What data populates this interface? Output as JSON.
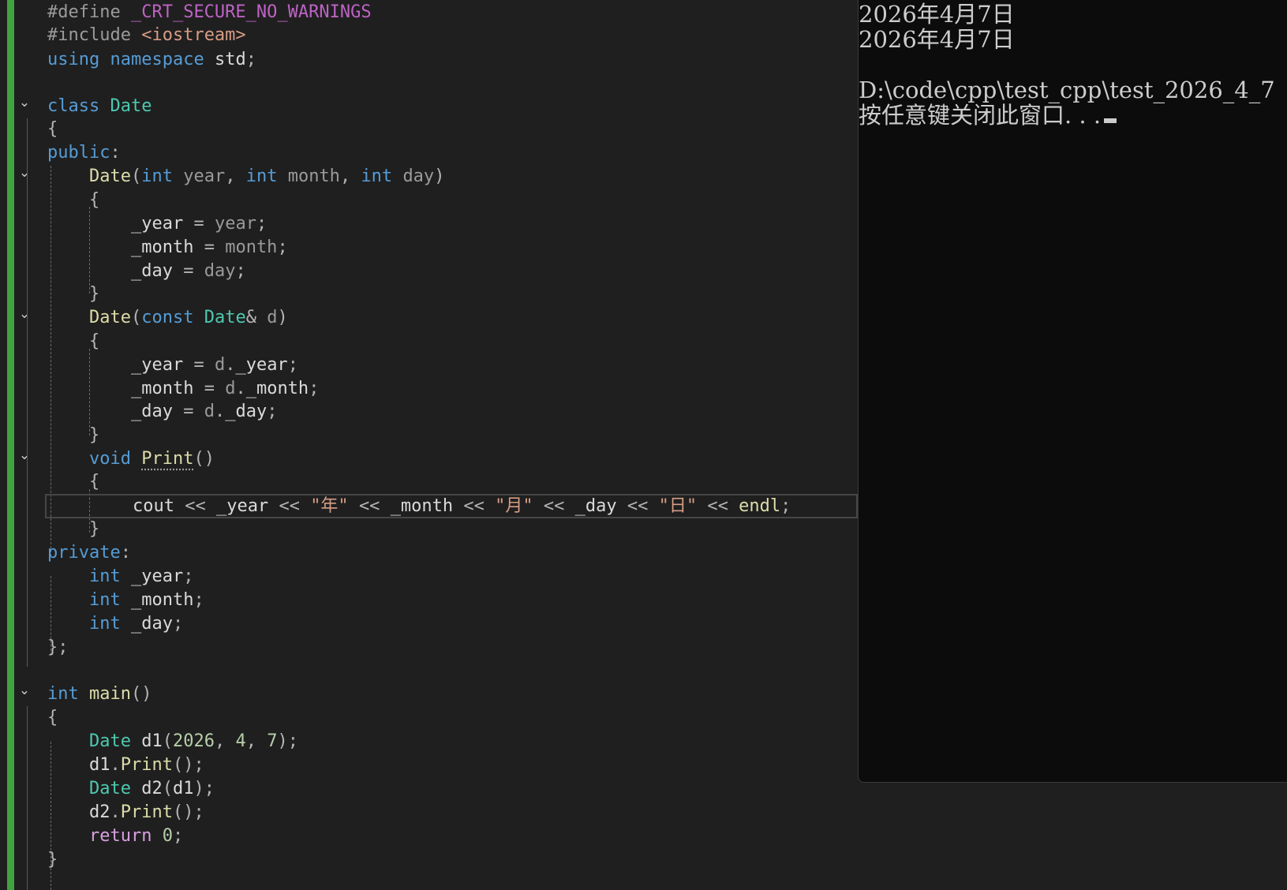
{
  "editor": {
    "code_lines": [
      "#define _CRT_SECURE_NO_WARNINGS",
      "#include <iostream>",
      "using namespace std;",
      "class Date",
      "{",
      "public:",
      "    Date(int year, int month, int day)",
      "    {",
      "        _year = year;",
      "        _month = month;",
      "        _day = day;",
      "    }",
      "    Date(const Date& d)",
      "    {",
      "        _year = d._year;",
      "        _month = d._month;",
      "        _day = d._day;",
      "    }",
      "    void Print()",
      "    {",
      "        cout << _year << \"年\" << _month << \"月\" << _day << \"日\" << endl;",
      "    }",
      "private:",
      "    int _year;",
      "    int _month;",
      "    int _day;",
      "};",
      "int main()",
      "{",
      "    Date d1(2026, 4, 7);",
      "    d1.Print();",
      "    Date d2(d1);",
      "    d2.Print();",
      "    return 0;",
      "}"
    ],
    "fold_icon": "chevron-down-icon"
  },
  "console": {
    "lines": [
      "2026年4月7日",
      "2026年4月7日",
      "",
      "D:\\code\\cpp\\test_cpp\\test_2026_4_7",
      "按任意键关闭此窗口. . ."
    ],
    "cursor": "blinking-block-cursor"
  },
  "colors": {
    "editor_bg": "#1f1f1f",
    "console_bg": "#0c0c0c",
    "change_bar": "#3fa43f",
    "keyword": "#569cd6",
    "type": "#4ec9b0",
    "function": "#dcdcaa",
    "string": "#d69d85",
    "macro": "#bd63c5"
  }
}
